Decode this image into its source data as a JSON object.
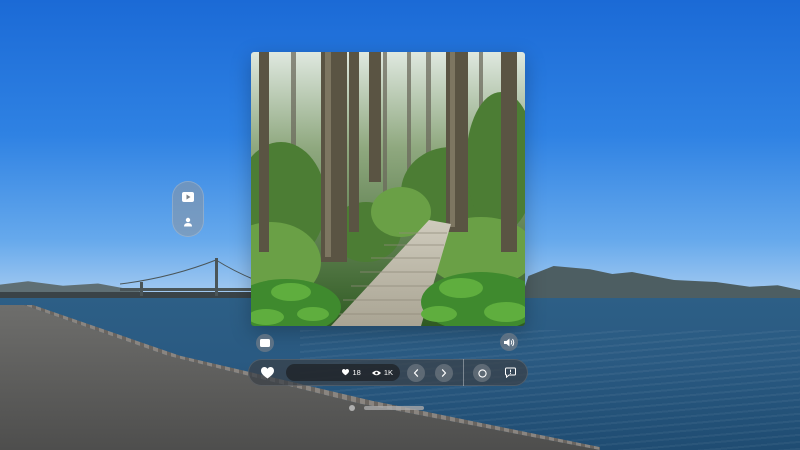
{
  "toolbar": {
    "likes_count": "18",
    "views_count": "1K"
  },
  "icons": {
    "photo_window": "forest-boardwalk-photo",
    "ornament_top": "play-icon",
    "ornament_bottom": "person-icon",
    "below_left": "photos-icon",
    "below_right": "speaker-icon",
    "like": "heart-icon",
    "stats_likes": "heart-icon",
    "stats_views": "eye-icon",
    "previous": "chevron-left-icon",
    "next": "chevron-right-icon",
    "record": "record-icon",
    "comment": "comment-icon"
  },
  "colors": {
    "toolbar_background": "#3a4046",
    "icon_foreground": "#ffffff"
  }
}
